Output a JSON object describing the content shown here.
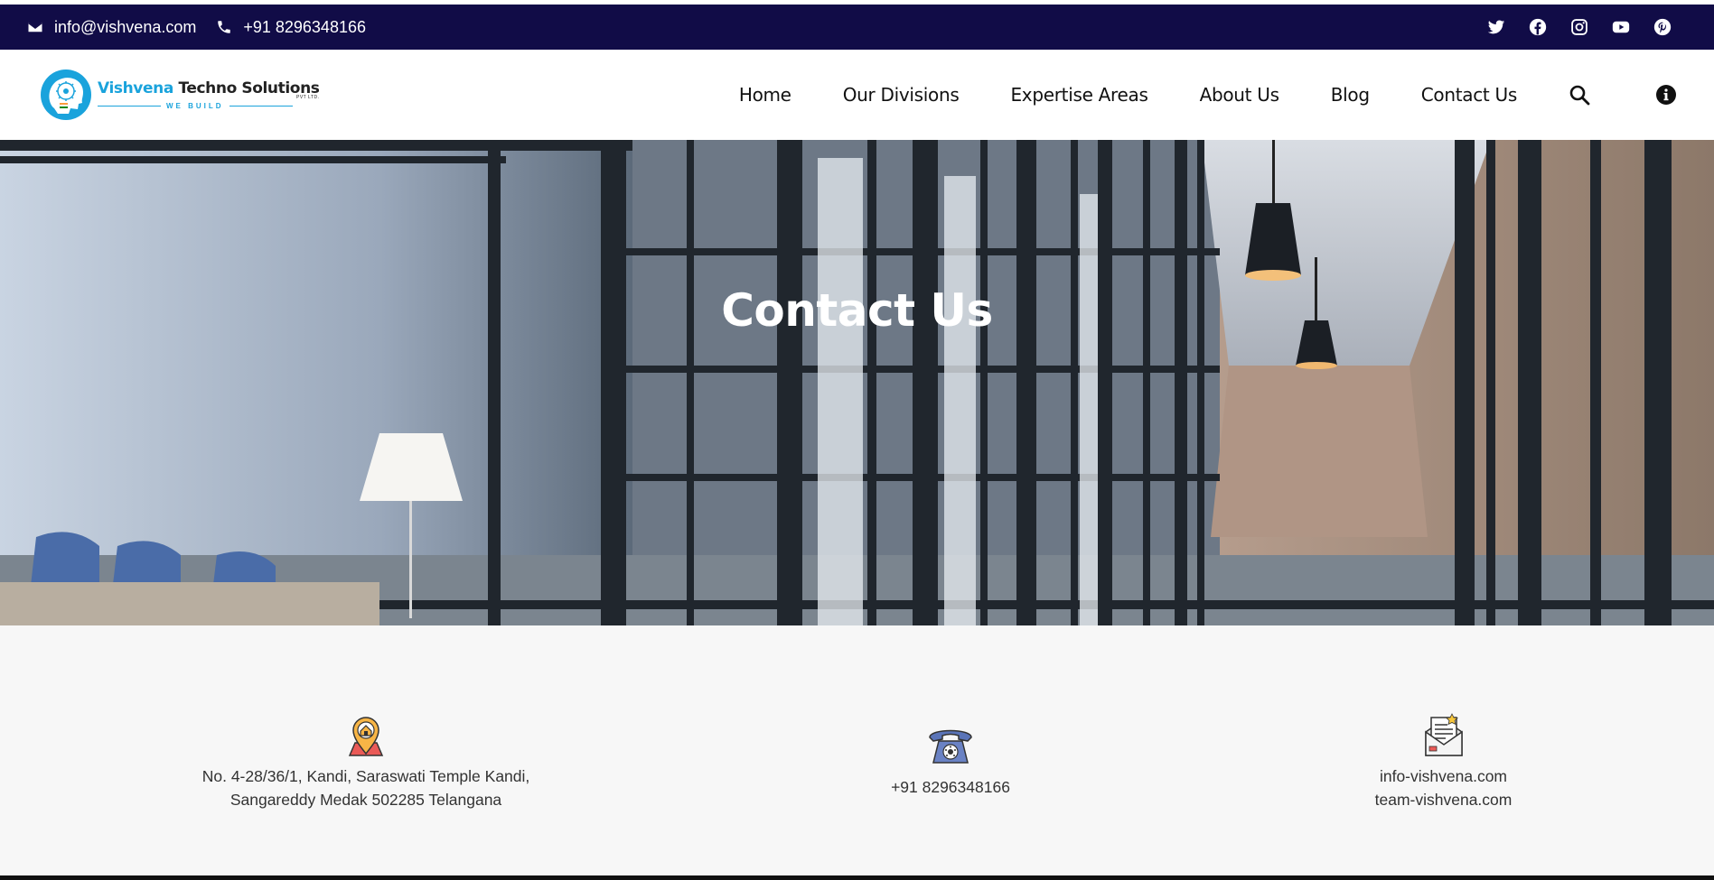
{
  "topbar": {
    "email": "info@vishvena.com",
    "phone": "+91 8296348166",
    "social": [
      "twitter-icon",
      "facebook-icon",
      "instagram-icon",
      "youtube-icon",
      "pinterest-icon"
    ],
    "background": "#110c47"
  },
  "logo": {
    "name_part1": "Vishvena",
    "name_part2": "Techno Solutions",
    "suffix": "PVT LTD.",
    "tagline": "WE BUILD"
  },
  "nav": {
    "items": [
      "Home",
      "Our Divisions",
      "Expertise Areas",
      "About Us",
      "Blog",
      "Contact Us"
    ],
    "icons": [
      "search-icon",
      "info-icon"
    ]
  },
  "hero": {
    "title": "Contact Us"
  },
  "contact_info": {
    "address_line1": "No. 4-28/36/1, Kandi, Saraswati Temple Kandi,",
    "address_line2": "Sangareddy Medak 502285 Telangana",
    "phone": "+91 8296348166",
    "email_line1": "info-vishvena.com",
    "email_line2": "team-vishvena.com"
  },
  "colors": {
    "brand_blue": "#1aa3dc",
    "topbar_navy": "#110c47",
    "section_bg": "#f7f7f7"
  }
}
